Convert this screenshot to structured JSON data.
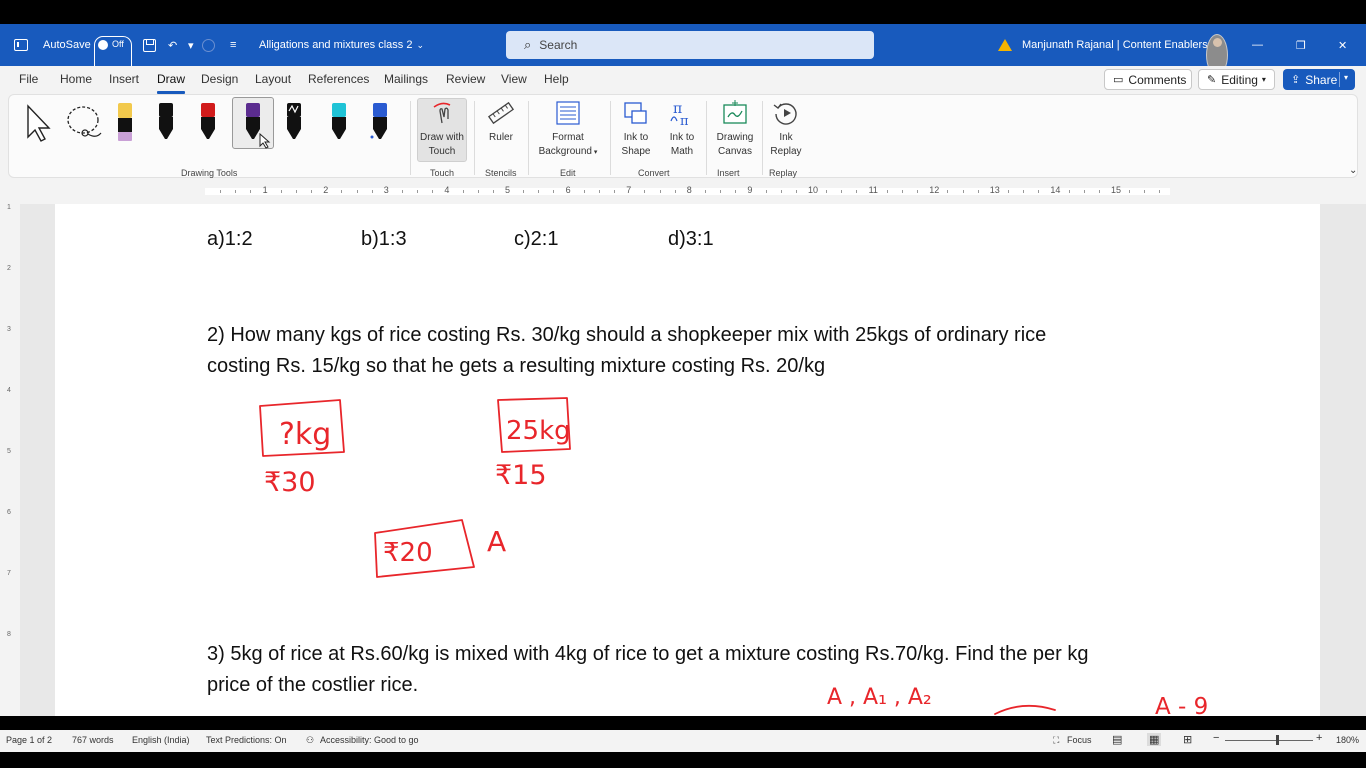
{
  "window": {
    "autosave_label": "AutoSave",
    "autosave_state": "Off",
    "doc_title": "Alligations and mixtures class 2",
    "search_placeholder": "Search",
    "user_name": "Manjunath Rajanal | Content Enablers"
  },
  "menu": {
    "tabs": [
      "File",
      "Home",
      "Insert",
      "Draw",
      "Design",
      "Layout",
      "References",
      "Mailings",
      "Review",
      "View",
      "Help"
    ],
    "active_tab": "Draw",
    "comments_label": "Comments",
    "editing_label": "Editing",
    "share_label": "Share"
  },
  "ribbon": {
    "groups": {
      "drawing_tools": "Drawing Tools",
      "touch": "Touch",
      "stencils": "Stencils",
      "edit": "Edit",
      "convert": "Convert",
      "insert": "Insert",
      "replay": "Replay"
    },
    "buttons": {
      "draw_with_touch_1": "Draw with",
      "draw_with_touch_2": "Touch",
      "ruler": "Ruler",
      "format_bg_1": "Format",
      "format_bg_2": "Background",
      "ink_shape_1": "Ink to",
      "ink_shape_2": "Shape",
      "ink_math_1": "Ink to",
      "ink_math_2": "Math",
      "drawing_canvas_1": "Drawing",
      "drawing_canvas_2": "Canvas",
      "ink_replay_1": "Ink",
      "ink_replay_2": "Replay"
    },
    "pen_colors": [
      "#111111",
      "#d11b1b",
      "#5b2c8f",
      "#111111",
      "#1fc3d6",
      "#2a5bd1"
    ],
    "highlighter_color": "#f2c94c"
  },
  "ruler": {
    "numbers": [
      "1",
      "2",
      "3",
      "4",
      "5",
      "6",
      "7",
      "8",
      "9",
      "10",
      "11",
      "12",
      "13",
      "14",
      "15"
    ],
    "vnumbers": [
      "1",
      "2",
      "3",
      "4",
      "5",
      "6",
      "7",
      "8"
    ]
  },
  "document": {
    "options": [
      "a)1:2",
      "b)1:3",
      "c)2:1",
      "d)3:1"
    ],
    "q2_line1": "2) How many kgs of rice costing Rs. 30/kg should a shopkeeper mix with 25kgs of ordinary rice",
    "q2_line2": "costing Rs. 15/kg so that he gets a resulting mixture costing Rs. 20/kg",
    "q3_line1": "3) 5kg of rice at Rs.60/kg is mixed with 4kg of rice to get a mixture costing Rs.70/kg. Find the per kg",
    "q3_line2": "price of the costlier rice.",
    "ink": {
      "box1": "?kg",
      "price1": "₹30",
      "box2": "25kg",
      "price2": "₹15",
      "box3": "₹20",
      "letter_a": "A",
      "a_series": "A , A₁ , A₂",
      "a_nine": "A - 9",
      "color": "#e8262b"
    }
  },
  "status": {
    "page": "Page 1 of 2",
    "words": "767 words",
    "language": "English (India)",
    "predictions": "Text Predictions: On",
    "accessibility": "Accessibility: Good to go",
    "focus": "Focus",
    "zoom": "180%"
  }
}
